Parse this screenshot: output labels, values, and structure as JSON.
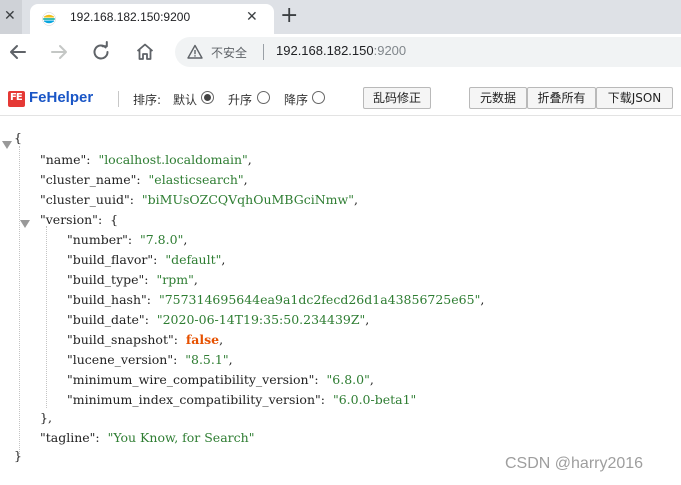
{
  "tab": {
    "title": "192.168.182.150:9200",
    "close_glyph": "✕",
    "new_tab_glyph": "+",
    "left_stub_close": "✕",
    "favicon": "elasticsearch-favicon"
  },
  "toolbar": {
    "back_icon": "back-arrow-icon",
    "forward_icon": "forward-arrow-icon",
    "reload_icon": "reload-icon",
    "home_icon": "home-icon",
    "security_label": "不安全",
    "url_host": "192.168.182.150",
    "url_port": ":9200"
  },
  "fehelper": {
    "brand": "FeHelper",
    "logo_text": "FE",
    "sort_label": "排序:",
    "sort_default": "默认",
    "sort_asc": "升序",
    "sort_desc": "降序",
    "sort_selected": "默认",
    "fix_encoding_btn": "乱码修正",
    "raw_data_btn": "元数据",
    "collapse_all_btn": "折叠所有",
    "download_json_btn": "下载JSON"
  },
  "json_view": {
    "name": "localhost.localdomain",
    "cluster_name": "elasticsearch",
    "cluster_uuid": "biMUsOZCQVqhOuMBGciNmw",
    "version": {
      "number": "7.8.0",
      "build_flavor": "default",
      "build_type": "rpm",
      "build_hash": "757314695644ea9a1dc2fecd26d1a43856725e65",
      "build_date": "2020-06-14T19:35:50.234439Z",
      "build_snapshot": "false",
      "lucene_version": "8.5.1",
      "minimum_wire_compatibility_version": "6.8.0",
      "minimum_index_compatibility_version": "6.0.0-beta1"
    },
    "tagline": "You Know, for Search"
  },
  "watermark": "CSDN @harry2016",
  "colors": {
    "tabstrip": "#dee1e6",
    "json_string": "#2e7d32",
    "json_bool": "#e65100",
    "fehelper_brand": "#1a56c6",
    "fehelper_logo": "#e53935"
  }
}
